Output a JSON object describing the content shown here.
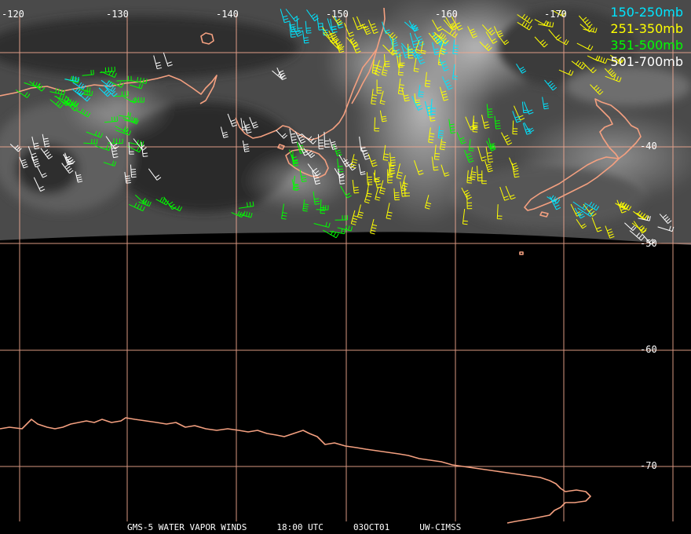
{
  "map": {
    "longitude_labels": [
      "-120",
      "-130",
      "-140",
      "-150",
      "-160",
      "-170"
    ],
    "latitude_labels": [
      "-40",
      "-50",
      "-60",
      "-70"
    ],
    "legend": [
      {
        "label": "150-250mb",
        "color": "#00e5ff"
      },
      {
        "label": "251-350mb",
        "color": "#ffff00"
      },
      {
        "label": "351-500mb",
        "color": "#00ff00"
      },
      {
        "label": "501-700mb",
        "color": "#ffffff"
      }
    ],
    "footer": {
      "satellite": "GMS-5 WATER VAPOR WINDS",
      "time": "18:00 UTC",
      "date": "03OCT01",
      "credit": "UW-CIMSS"
    },
    "colors": {
      "grid": "#f0a890",
      "coastline": "#f4a080",
      "background": "#000000"
    }
  }
}
